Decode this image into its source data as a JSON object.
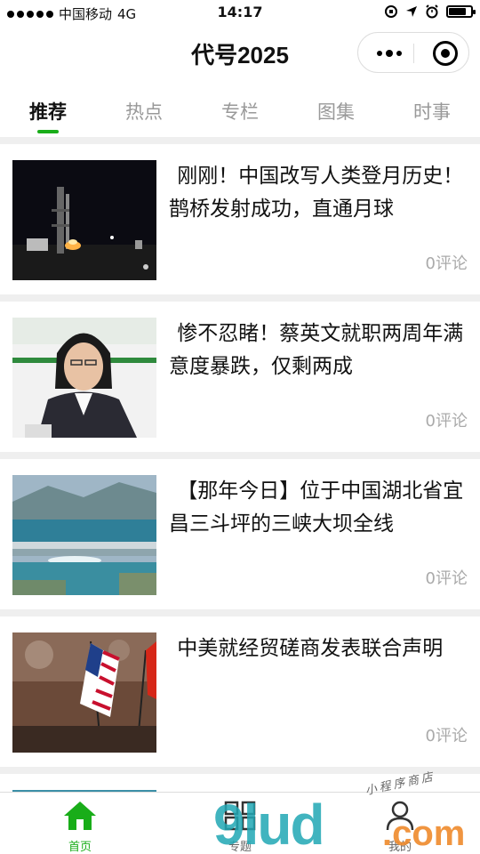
{
  "status_bar": {
    "carrier": "中国移动",
    "network": "4G",
    "time": "14:17",
    "battery_level": 0.8
  },
  "header": {
    "title": "代号2025"
  },
  "tabs": [
    {
      "label": "推荐",
      "active": true
    },
    {
      "label": "热点",
      "active": false
    },
    {
      "label": "专栏",
      "active": false
    },
    {
      "label": "图集",
      "active": false
    },
    {
      "label": "时事",
      "active": false
    }
  ],
  "articles": [
    {
      "title": "刚刚！中国改写人类登月历史！鹊桥发射成功，直通月球",
      "comments": "0评论",
      "image": "rocket-launch-photo"
    },
    {
      "title": "惨不忍睹！蔡英文就职两周年满意度暴跌，仅剩两成",
      "comments": "0评论",
      "image": "portrait-photo"
    },
    {
      "title": "【那年今日】位于中国湖北省宜昌三斗坪的三峡大坝全线",
      "comments": "0评论",
      "image": "dam-aerial-photo"
    },
    {
      "title": "中美就经贸磋商发表联合声明",
      "comments": "0评论",
      "image": "flags-photo"
    }
  ],
  "bottom_nav": [
    {
      "label": "首页",
      "icon": "home-icon",
      "active": true
    },
    {
      "label": "专题",
      "icon": "grid-icon",
      "active": false
    },
    {
      "label": "我的",
      "icon": "user-icon",
      "active": false
    }
  ],
  "watermark": {
    "main": "9lud",
    "suffix": ".com",
    "small": "小程序商店"
  },
  "colors": {
    "accent": "#19ad19",
    "feed_bg": "#efefef",
    "comment_text": "#aaaaaa"
  }
}
